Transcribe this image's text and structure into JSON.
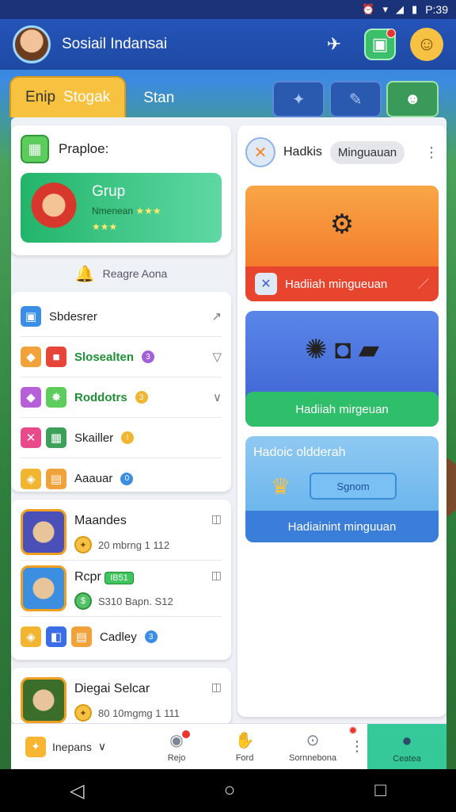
{
  "status_bar": {
    "time": "P:39"
  },
  "header": {
    "title": "Sosiail Indansai"
  },
  "tabs": [
    {
      "part1": "Enip",
      "part2": "Stogak"
    },
    {
      "label": "Stan"
    }
  ],
  "profile_card": {
    "title": "Praploe:",
    "group_title": "Grup",
    "group_sub": "Nmenean"
  },
  "notice": {
    "text": "Reagre Aona"
  },
  "list_card": {
    "rows": [
      {
        "label": "Sbdesrer"
      },
      {
        "label": "Slosealten",
        "badge": "3"
      },
      {
        "label": "Roddotrs",
        "badge": "3"
      },
      {
        "label": "Skailler",
        "badge": "!"
      },
      {
        "label": "Aaauar",
        "badge": "0"
      }
    ]
  },
  "games": [
    {
      "name": "Maandes",
      "meta": "20 mbrng 1 112"
    },
    {
      "name": "Rcpr",
      "level": "IB51",
      "meta": "S310 Bapn. S12"
    },
    {
      "name": "Cadley",
      "badge": "3"
    },
    {
      "name": "Diegai Selcar",
      "meta": "80 10mgmg 1 111"
    }
  ],
  "rewards": {
    "title": "Hadkis",
    "pill": "Minguauan",
    "block1_label": "Hadiiah mingueuan",
    "block2_label": "Hadiiah mirgeuan",
    "block3_title": "Hadoic oldderah",
    "block3_button": "Sgnom",
    "block3_label": "Hadiainint minguuan"
  },
  "bottom_nav": {
    "first": "Inepans",
    "items": [
      "Rejo",
      "Ford",
      "Sornnebona"
    ],
    "active": "Ceatea"
  }
}
